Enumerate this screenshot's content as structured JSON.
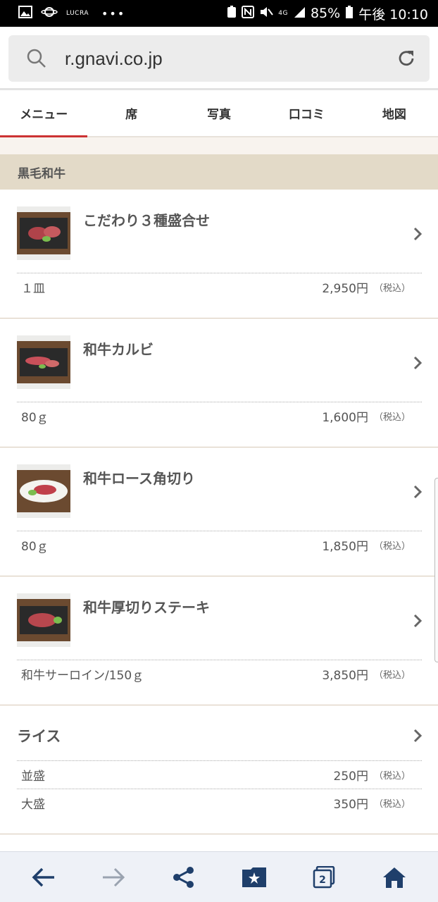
{
  "status_bar": {
    "carrier_label": "LUCRA",
    "battery": "85%",
    "network": "4G",
    "time": "午後 10:10"
  },
  "browser": {
    "url": "r.gnavi.co.jp",
    "icons": [
      "search-icon",
      "reload-icon"
    ]
  },
  "tabs": [
    {
      "label": "メニュー",
      "active": true
    },
    {
      "label": "席",
      "active": false
    },
    {
      "label": "写真",
      "active": false
    },
    {
      "label": "口コミ",
      "active": false
    },
    {
      "label": "地図",
      "active": false
    }
  ],
  "category": {
    "title": "黒毛和牛"
  },
  "items": [
    {
      "name": "こだわり３種盛合せ",
      "quantity": "１皿",
      "price": "2,950円",
      "tax": "（税込）"
    },
    {
      "name": "和牛カルビ",
      "quantity": "80ｇ",
      "price": "1,600円",
      "tax": "（税込）"
    },
    {
      "name": "和牛ロース角切り",
      "quantity": "80ｇ",
      "price": "1,850円",
      "tax": "（税込）"
    },
    {
      "name": "和牛厚切りステーキ",
      "quantity": "和牛サーロイン/150ｇ",
      "price": "3,850円",
      "tax": "（税込）"
    }
  ],
  "rice": {
    "name": "ライス",
    "options": [
      {
        "label": "並盛",
        "price": "250円",
        "tax": "（税込）"
      },
      {
        "label": "大盛",
        "price": "350円",
        "tax": "（税込）"
      }
    ]
  },
  "bottom_nav": {
    "buttons": [
      "back-arrow-icon",
      "forward-arrow-icon",
      "share-icon",
      "bookmarks-icon",
      "tabs-icon",
      "home-icon"
    ],
    "tab_count": "2"
  },
  "colors": {
    "accent": "#cc3333",
    "category_bg": "#e3dac8",
    "nav_icon": "#1f3f6b"
  }
}
